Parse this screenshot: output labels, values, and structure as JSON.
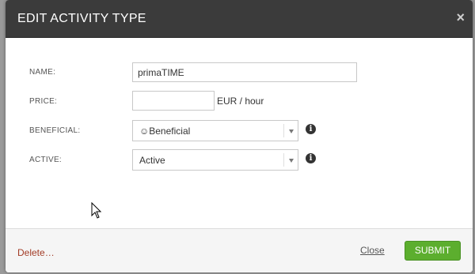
{
  "dialog": {
    "title": "EDIT ACTIVITY TYPE",
    "close_icon": "×"
  },
  "form": {
    "name": {
      "label": "NAME:",
      "value": "primaTIME"
    },
    "price": {
      "label": "PRICE:",
      "value": "",
      "unit": "EUR / hour"
    },
    "beneficial": {
      "label": "BENEFICIAL:",
      "value": "☺Beneficial",
      "icon": "info-icon"
    },
    "active": {
      "label": "ACTIVE:",
      "value": "Active",
      "icon": "info-icon"
    }
  },
  "footer": {
    "delete_label": "Delete…",
    "close_label": "Close",
    "submit_label": "SUBMIT"
  },
  "colors": {
    "header_bg": "#3b3b3b",
    "submit_bg": "#5cae2e",
    "delete_link": "#a23b25"
  }
}
